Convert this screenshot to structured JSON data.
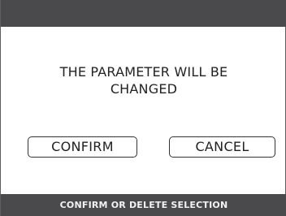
{
  "dialog": {
    "message_line1": "THE PARAMETER WILL BE",
    "message_line2": "CHANGED"
  },
  "buttons": {
    "confirm_label": "CONFIRM",
    "cancel_label": "CANCEL"
  },
  "footer": {
    "status_text": "CONFIRM OR DELETE SELECTION"
  },
  "colors": {
    "bar_background": "#4a4a4c",
    "screen_background": "#ffffff",
    "text": "#222222",
    "footer_text": "#f2f2f2"
  }
}
